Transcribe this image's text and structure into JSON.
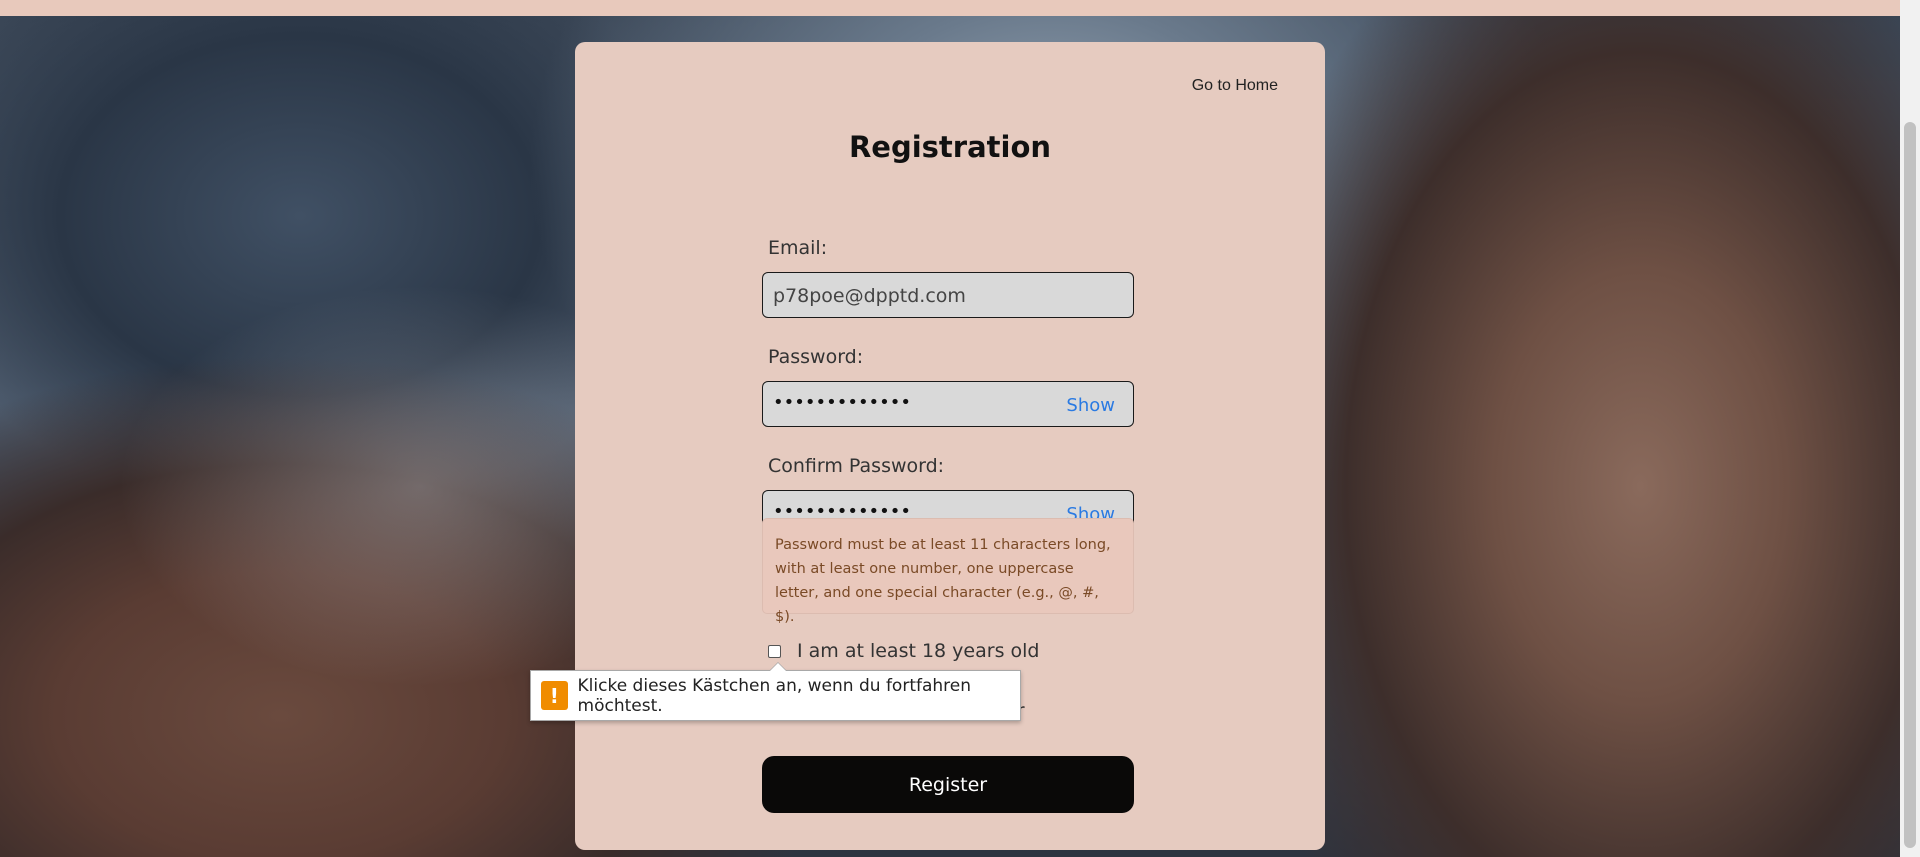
{
  "nav": {
    "home_link": "Go to Home"
  },
  "form": {
    "title": "Registration",
    "email_label": "Email:",
    "email_value": "p78poe@dpptd.com",
    "password_label": "Password:",
    "password_value": "•••••••••••••",
    "confirm_label": "Confirm Password:",
    "confirm_value": "•••••••••••••",
    "show_label": "Show",
    "hint": "Password must be at least 11 characters long, with at least one number, one uppercase letter, and one special character (e.g., @, #, $).",
    "age_checkbox_label": "I am at least 18 years old",
    "age_checkbox_checked": false,
    "second_checkbox_label_visible_tail": "er",
    "register_button": "Register"
  },
  "validation_tooltip": {
    "icon": "warning-icon",
    "icon_glyph": "!",
    "message": "Klicke dieses Kästchen an, wenn du fortfahren möchtest."
  },
  "colors": {
    "card_bg": "#e6cbc0",
    "accent_link": "#2a7ae2",
    "button_bg": "#0a0908",
    "warning": "#f08c00"
  }
}
